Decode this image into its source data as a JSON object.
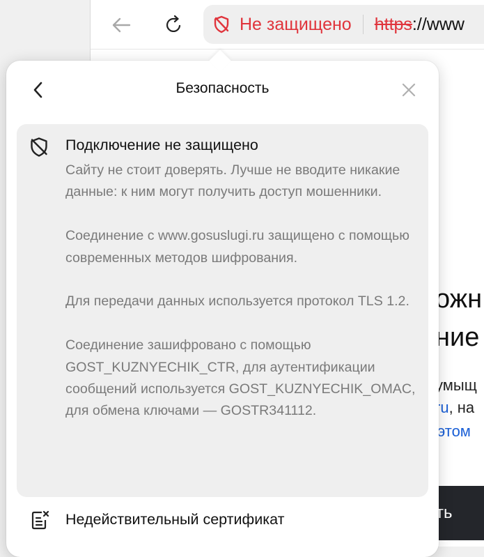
{
  "toolbar": {
    "status_text": "Не защищено",
    "url_protocol": "https",
    "url_rest": "://www"
  },
  "background_page": {
    "heading_line1": "ожн",
    "heading_line2": "ние",
    "paragraph_line1": "умыщ",
    "paragraph_line2_blue": "ru",
    "paragraph_line2_rest": ", на",
    "link_text": "этом",
    "button_label": "ть"
  },
  "popup": {
    "title": "Безопасность",
    "card": {
      "title": "Подключение не защищено",
      "paragraphs": [
        "Сайту не стоит доверять. Лучше не вводите никакие данные: к ним могут получить доступ мошенники.",
        "Соединение с www.gosuslugi.ru защищено с помощью современных методов шифрования.",
        "Для передачи данных используется протокол TLS 1.2.",
        "Соединение зашифровано с помощью GOST_KUZNYECHIK_CTR, для аутентификации сообщений используется GOST_KUZNYECHIK_OMAC, для обмена ключами — GOSTR341112."
      ]
    },
    "certificate_label": "Недействительный сертификат"
  },
  "colors": {
    "danger": "#e0343c",
    "link": "#1a5fd6",
    "card_bg": "#efefef",
    "muted_text": "#7a7a7a"
  },
  "icons": [
    "back-arrow-icon",
    "reload-icon",
    "shield-crossed-icon",
    "chevron-left-icon",
    "close-icon",
    "certificate-icon"
  ]
}
